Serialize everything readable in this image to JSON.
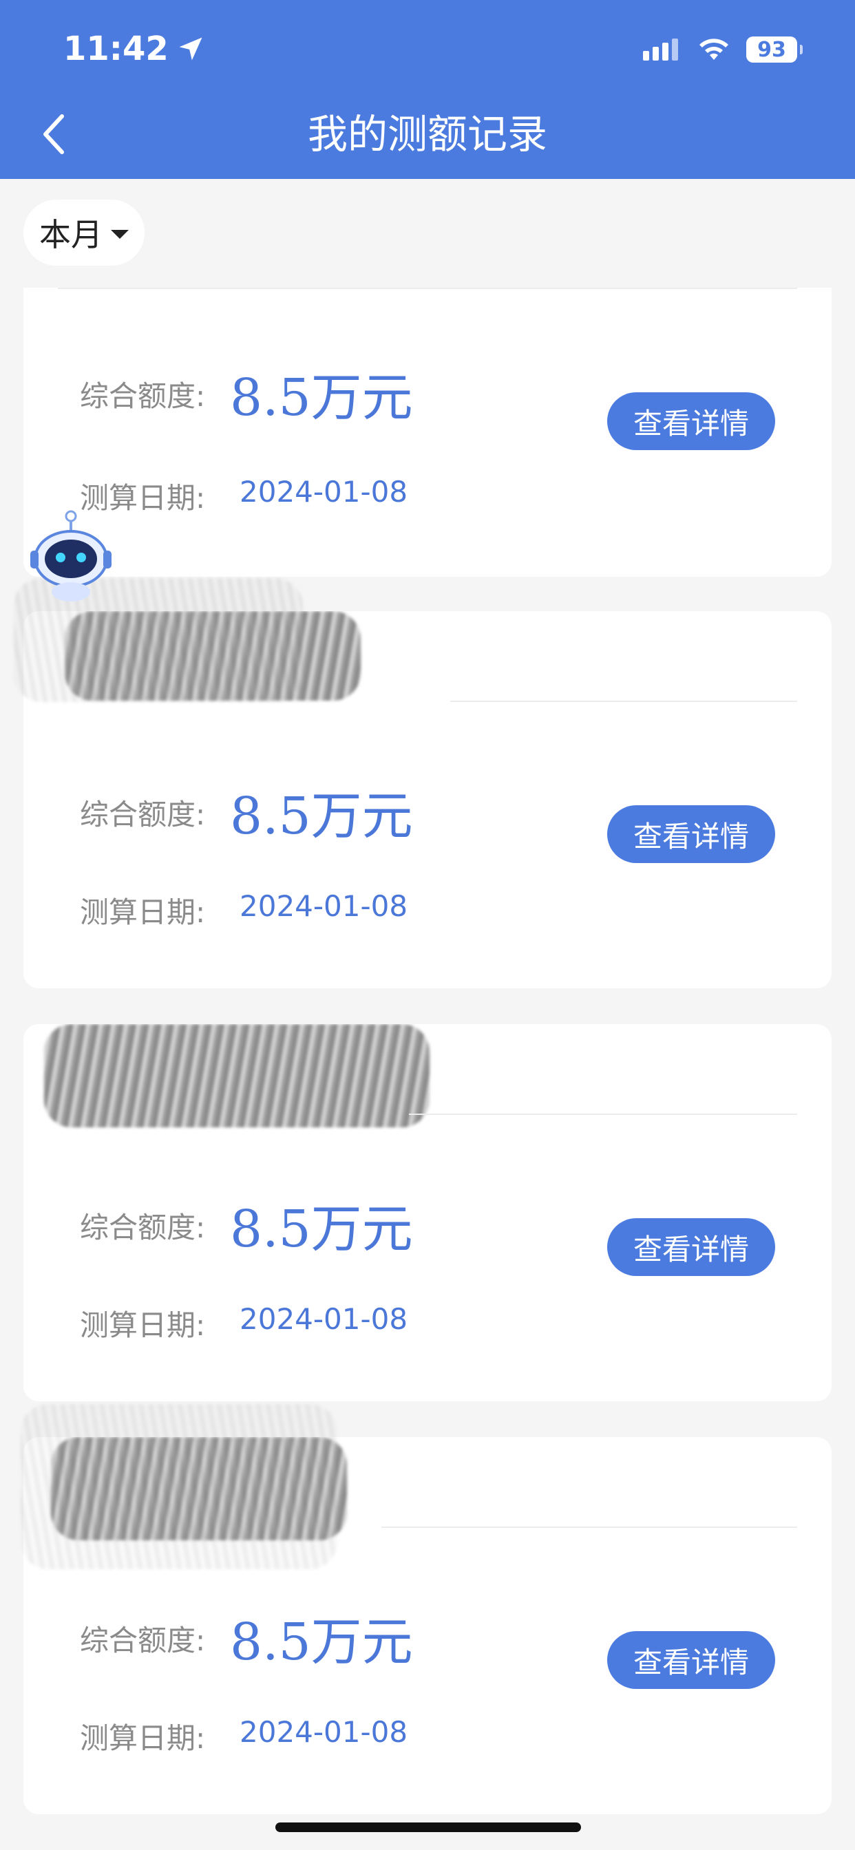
{
  "status_bar": {
    "time": "11:42",
    "battery": "93"
  },
  "header": {
    "title": "我的测额记录"
  },
  "filter": {
    "label": "本月"
  },
  "records": [
    {
      "quota_label": "综合额度:",
      "quota_value": "8.5万元",
      "date_label": "测算日期:",
      "date_value": "2024-01-08",
      "button_label": "查看详情"
    },
    {
      "name_partial": "",
      "quota_label": "综合额度:",
      "quota_value": "8.5万元",
      "date_label": "测算日期:",
      "date_value": "2024-01-08",
      "button_label": "查看详情"
    },
    {
      "name_partial": "",
      "quota_label": "综合额度:",
      "quota_value": "8.5万元",
      "date_label": "测算日期:",
      "date_value": "2024-01-08",
      "button_label": "查看详情"
    },
    {
      "name_partial": "",
      "quota_label": "综合额度:",
      "quota_value": "8.5万元",
      "date_label": "测算日期:",
      "date_value": "2024-01-08",
      "button_label": "查看详情"
    }
  ],
  "colors": {
    "primary": "#4c7be0",
    "value_text": "#4a77d8",
    "background": "#f5f5f5"
  },
  "icons": [
    "location-arrow-icon",
    "signal-icon",
    "wifi-icon",
    "battery-icon",
    "back-chevron-icon",
    "dropdown-caret-icon",
    "robot-mascot-icon"
  ]
}
